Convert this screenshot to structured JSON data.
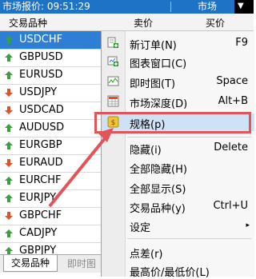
{
  "title_bar": {
    "title": "市场报价: 09:51:29",
    "right_title": "市场",
    "dark_arrow": "▼"
  },
  "header": {
    "col_symbol": "交易品种",
    "col_bid": "卖价",
    "col_ask": "买价"
  },
  "symbols": [
    {
      "name": "USDCHF",
      "dir": "up",
      "selected": true
    },
    {
      "name": "GBPUSD",
      "dir": "up"
    },
    {
      "name": "EURUSD",
      "dir": "up"
    },
    {
      "name": "USDJPY",
      "dir": "down"
    },
    {
      "name": "USDCAD",
      "dir": "down"
    },
    {
      "name": "AUDUSD",
      "dir": "up"
    },
    {
      "name": "EURGBP",
      "dir": "up"
    },
    {
      "name": "EURAUD",
      "dir": "down"
    },
    {
      "name": "EURCHF",
      "dir": "up"
    },
    {
      "name": "EURJPY",
      "dir": "up"
    },
    {
      "name": "GBPCHF",
      "dir": "down"
    },
    {
      "name": "CADJPY",
      "dir": "up"
    },
    {
      "name": "GBPJPY",
      "dir": "up"
    }
  ],
  "tabs": {
    "tab1": "交易品种",
    "tab2": "即时图"
  },
  "menu": {
    "items": [
      {
        "label": "新订单(N)",
        "shortcut": "F9",
        "icon": "new-order-icon"
      },
      {
        "label": "图表窗口(C)",
        "shortcut": "",
        "icon": "chart-window-icon"
      },
      {
        "label": "即时图(T)",
        "shortcut": "Space",
        "icon": "tick-chart-icon"
      },
      {
        "label": "市场深度(D)",
        "shortcut": "Alt+B",
        "icon": "market-depth-icon"
      },
      {
        "label": "规格(p)",
        "shortcut": "",
        "icon": "specification-icon",
        "highlighted": true
      },
      {
        "label": "隐藏(i)",
        "shortcut": "Delete"
      },
      {
        "label": "全部隐藏(H)",
        "shortcut": ""
      },
      {
        "label": "全部显示(S)",
        "shortcut": ""
      },
      {
        "label": "交易品种(y)",
        "shortcut": "Ctrl+U"
      },
      {
        "label": "设定",
        "shortcut": "▸"
      },
      {
        "label": "点差(r)",
        "shortcut": ""
      },
      {
        "label": "最高价/最低价(L)",
        "shortcut": ""
      }
    ]
  },
  "colors": {
    "accent": "#2d7fd6",
    "title_bar": "#1f73c6",
    "annotation": "#e0545a",
    "up": "#3aa03a",
    "down": "#d9542b"
  }
}
